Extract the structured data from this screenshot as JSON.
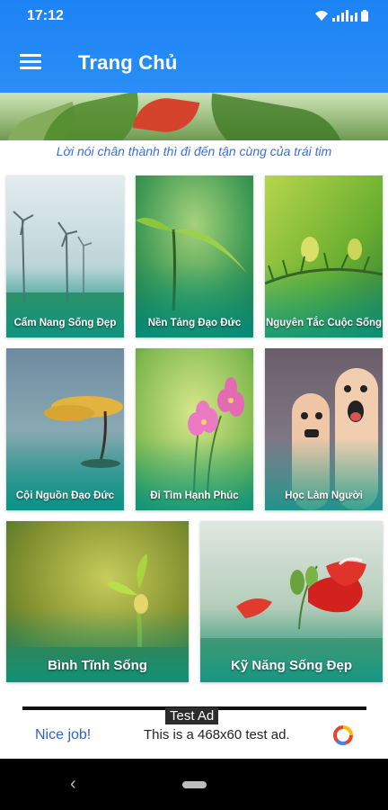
{
  "status_bar": {
    "time": "17:12",
    "wifi_icon": "wifi-icon",
    "signal_icon": "signal-icon",
    "battery_icon": "battery-icon"
  },
  "app_bar": {
    "title": "Trang Chủ",
    "menu_icon": "hamburger-menu-icon"
  },
  "banner": {
    "image": "leaves-banner-image"
  },
  "quote": "Lời nói chân thành thì đi đến tận cùng của trái tim",
  "categories": [
    {
      "label": "Cẩm Nang Sống Đẹp",
      "image": "wind-turbines-image"
    },
    {
      "label": "Nền Tảng Đạo Đức",
      "image": "sprout-image"
    },
    {
      "label": "Nguyên Tắc Cuộc Sống",
      "image": "pine-branch-image"
    },
    {
      "label": "Cội Nguồn Đạo Đức",
      "image": "tree-in-water-image"
    },
    {
      "label": "Đi Tìm Hạnh Phúc",
      "image": "pink-flowers-image"
    },
    {
      "label": "Học Làm Người",
      "image": "finger-faces-image"
    },
    {
      "label": "Bình Tĩnh Sống",
      "image": "seedling-image"
    },
    {
      "label": "Kỹ Năng Sống Đẹp",
      "image": "red-flowers-image"
    }
  ],
  "ad": {
    "tag": "Test Ad",
    "headline": "Nice job!",
    "body": "This is a 468x60 test ad.",
    "logo_icon": "ad-logo-icon"
  },
  "nav_bar": {
    "back_icon": "‹",
    "home_icon": "home-pill-icon"
  },
  "colors": {
    "app_bar": "#1c83f4",
    "quote_text": "#3b6fd6",
    "card_overlay": "#009688",
    "ad_headline": "#2f62c7"
  }
}
